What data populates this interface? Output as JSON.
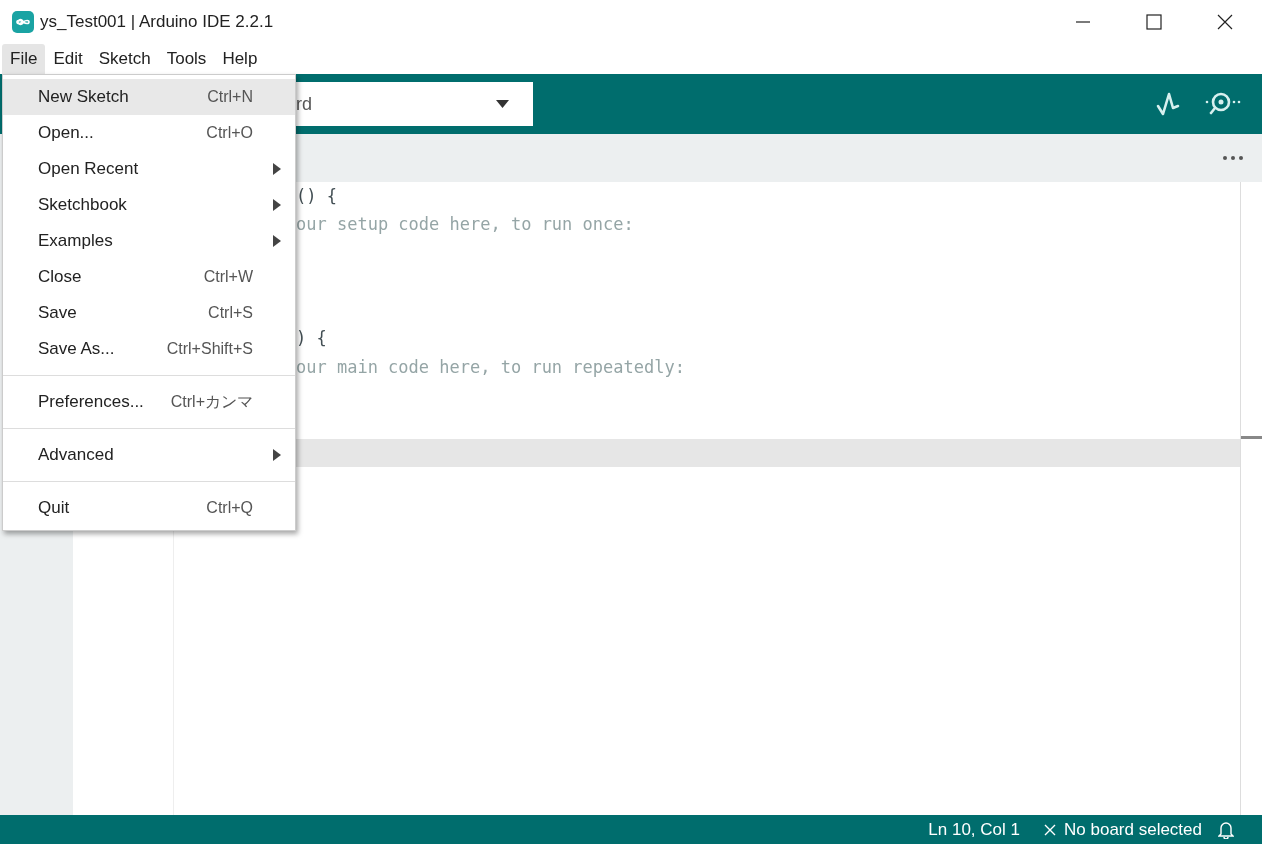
{
  "window": {
    "title": "ys_Test001 | Arduino IDE 2.2.1"
  },
  "menubar": [
    {
      "label": "File",
      "selected": true
    },
    {
      "label": "Edit",
      "selected": false
    },
    {
      "label": "Sketch",
      "selected": false
    },
    {
      "label": "Tools",
      "selected": false
    },
    {
      "label": "Help",
      "selected": false
    }
  ],
  "board_select": {
    "value": "rd"
  },
  "code_lines": [
    {
      "text": "() {",
      "current": false
    },
    {
      "text": "our setup code here, to run once:",
      "current": false
    },
    {
      "current": false
    },
    {
      "current": false
    },
    {
      "current": false
    },
    {
      "text": ") {",
      "current": false
    },
    {
      "text": "our main code here, to run repeatedly:",
      "current": false
    },
    {
      "current": false
    },
    {
      "current": false
    },
    {
      "current": true
    }
  ],
  "file_menu": [
    {
      "kind": "item",
      "label": "New Sketch",
      "shortcut": "Ctrl+N",
      "highlighted": true
    },
    {
      "kind": "item",
      "label": "Open...",
      "shortcut": "Ctrl+O",
      "highlighted": false
    },
    {
      "kind": "submenu",
      "label": "Open Recent",
      "highlighted": false
    },
    {
      "kind": "submenu",
      "label": "Sketchbook",
      "highlighted": false
    },
    {
      "kind": "submenu",
      "label": "Examples",
      "highlighted": false
    },
    {
      "kind": "item",
      "label": "Close",
      "shortcut": "Ctrl+W",
      "highlighted": false
    },
    {
      "kind": "item",
      "label": "Save",
      "shortcut": "Ctrl+S",
      "highlighted": false
    },
    {
      "kind": "item",
      "label": "Save As...",
      "shortcut": "Ctrl+Shift+S",
      "highlighted": false
    },
    {
      "kind": "separator"
    },
    {
      "kind": "item",
      "label": "Preferences...",
      "shortcut": "Ctrl+カンマ",
      "highlighted": false
    },
    {
      "kind": "separator"
    },
    {
      "kind": "submenu",
      "label": "Advanced",
      "highlighted": false
    },
    {
      "kind": "separator"
    },
    {
      "kind": "item",
      "label": "Quit",
      "shortcut": "Ctrl+Q",
      "highlighted": false
    }
  ],
  "status_bar": {
    "position": "Ln 10, Col 1",
    "board": "No board selected"
  }
}
